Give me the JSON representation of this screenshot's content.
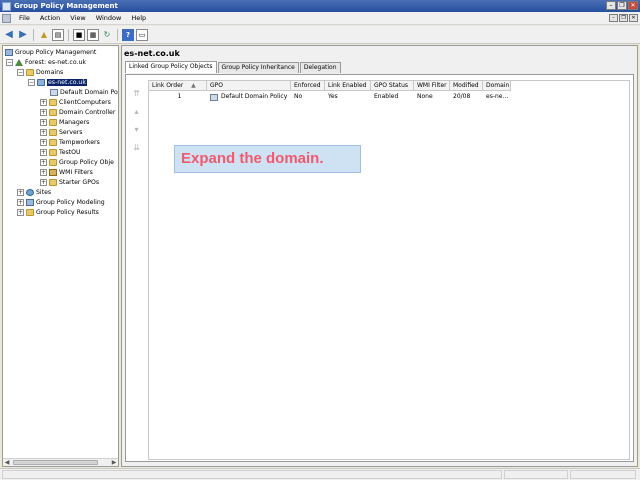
{
  "window": {
    "title": "Group Policy Management"
  },
  "menu": [
    "File",
    "Action",
    "View",
    "Window",
    "Help"
  ],
  "tree": {
    "root": "Group Policy Management",
    "forest": "Forest: es-net.co.uk",
    "domains": "Domains",
    "domain": "es-net.co.uk",
    "children": [
      "Default Domain Po",
      "ClientComputers",
      "Domain Controller",
      "Managers",
      "Servers",
      "Tempworkers",
      "TestOU",
      "Group Policy Obje",
      "WMI Filters",
      "Starter GPOs"
    ],
    "sites": "Sites",
    "modeling": "Group Policy Modeling",
    "results": "Group Policy Results"
  },
  "content": {
    "title": "es-net.co.uk",
    "tabs": [
      "Linked Group Policy Objects",
      "Group Policy Inheritance",
      "Delegation"
    ],
    "columns": [
      "Link Order",
      "GPO",
      "Enforced",
      "Link Enabled",
      "GPO Status",
      "WMI Filter",
      "Modified",
      "Domain"
    ],
    "rows": [
      {
        "link_order": "1",
        "gpo": "Default Domain Policy",
        "enforced": "No",
        "link_enabled": "Yes",
        "status": "Enabled",
        "wmi_filter": "None",
        "modified": "20/08",
        "domain": "es-ne..."
      }
    ]
  },
  "callout": "Expand the domain.",
  "icons": {
    "back": "back-arrow-icon",
    "forward": "forward-arrow-icon",
    "help": "help-icon"
  }
}
